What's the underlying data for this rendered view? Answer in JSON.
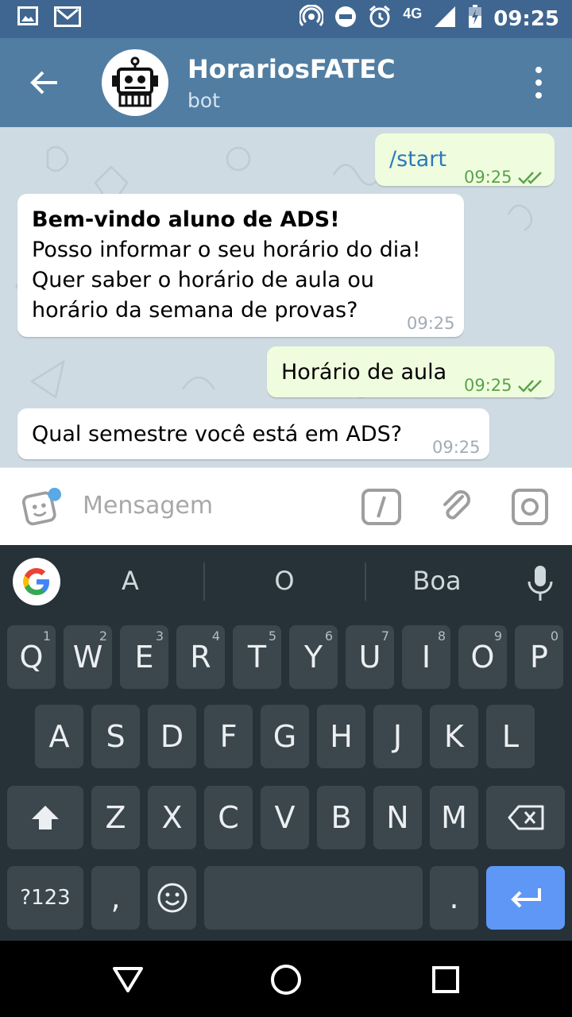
{
  "status_bar": {
    "time": "09:25",
    "network": "4G"
  },
  "header": {
    "title": "HorariosFATEC",
    "subtitle": "bot"
  },
  "messages": [
    {
      "dir": "out",
      "text": "/start",
      "time": "09:25"
    },
    {
      "dir": "in",
      "bold": "Bem-vindo aluno de ADS!",
      "lines": [
        "Posso informar o seu horário do dia!",
        "Quer saber o horário de aula ou",
        "horário da semana de provas?"
      ],
      "time": "09:25"
    },
    {
      "dir": "out",
      "text": "Horário de aula",
      "time": "09:25"
    },
    {
      "dir": "in",
      "text": "Qual semestre você está em ADS?",
      "time": "09:25"
    }
  ],
  "input": {
    "placeholder": "Mensagem"
  },
  "keyboard": {
    "suggestions": [
      "A",
      "O",
      "Boa"
    ],
    "row1": [
      {
        "key": "Q",
        "hint": "1"
      },
      {
        "key": "W",
        "hint": "2"
      },
      {
        "key": "E",
        "hint": "3"
      },
      {
        "key": "R",
        "hint": "4"
      },
      {
        "key": "T",
        "hint": "5"
      },
      {
        "key": "Y",
        "hint": "6"
      },
      {
        "key": "U",
        "hint": "7"
      },
      {
        "key": "I",
        "hint": "8"
      },
      {
        "key": "O",
        "hint": "9"
      },
      {
        "key": "P",
        "hint": "0"
      }
    ],
    "row2": [
      "A",
      "S",
      "D",
      "F",
      "G",
      "H",
      "J",
      "K",
      "L"
    ],
    "row3": [
      "Z",
      "X",
      "C",
      "V",
      "B",
      "N",
      "M"
    ],
    "symbols_key": "?123",
    "comma_key": ",",
    "period_key": "."
  },
  "colors": {
    "header": "#517da2",
    "status_bar": "#3f6690",
    "outgoing_bubble": "#effdde",
    "enter_key": "#5e97f6"
  }
}
